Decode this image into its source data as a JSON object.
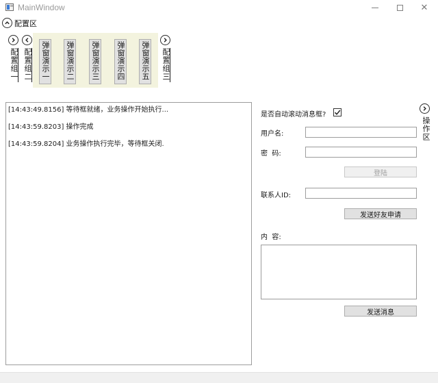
{
  "window": {
    "title": "MainWindow",
    "close_glyph": "✕"
  },
  "config": {
    "label": "配置区",
    "groups": [
      "配置组一",
      "配置组二",
      "配置组三"
    ]
  },
  "popup_buttons": [
    "弹窗演示一",
    "弹窗演示二",
    "弹窗演示三",
    "弹窗演示四",
    "弹窗演示五"
  ],
  "log": {
    "lines": [
      "[14:43:49.8156] 等待框就绪，业务操作开始执行...",
      "[14:43:59.8203] 操作完成",
      "[14:43:59.8204] 业务操作执行完毕，等待框关闭."
    ]
  },
  "form": {
    "auto_scroll_label": "是否自动滚动消息框?",
    "auto_scroll_checked": true,
    "username_label": "用户名:",
    "username_value": "",
    "password_label": "密  码:",
    "password_value": "",
    "login_button": "登陆",
    "contact_id_label": "联系人ID:",
    "contact_id_value": "",
    "friend_request_button": "发送好友申请",
    "content_label": "内  容:",
    "content_value": "",
    "send_button": "发送消息"
  },
  "operation": {
    "label": "操作区"
  },
  "icons": {
    "config_toggle": "chevron-up-icon",
    "group_expand": "chevron-right-icon",
    "group_collapse": "chevron-left-icon",
    "check": "checkmark-icon"
  }
}
